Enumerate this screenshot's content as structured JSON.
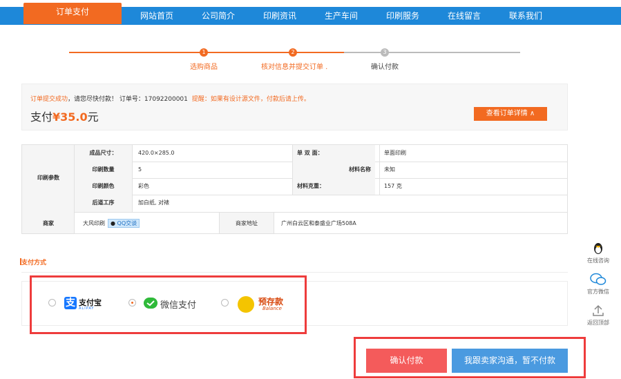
{
  "nav": {
    "active": "订单支付",
    "items": [
      "网站首页",
      "公司简介",
      "印刷资讯",
      "生产车间",
      "印刷服务",
      "在线留言",
      "联系我们"
    ]
  },
  "steps": {
    "items": [
      {
        "num": "1",
        "label": "选购商品"
      },
      {
        "num": "2",
        "label": "核对信息并提交订单 ."
      },
      {
        "num": "3",
        "label": "确认付款"
      }
    ]
  },
  "order": {
    "success": "订单提交成功",
    "pay_prompt": "，请您尽快付款！ 订单号：",
    "order_no": "17092200001",
    "tip": "提醒：如果有设计源文件，付款后请上传。",
    "pay_label": "支付",
    "price": "¥35.0",
    "unit": "元",
    "detail_button": "查看订单详情 ∧"
  },
  "params": {
    "section_label": "印刷参数",
    "rows": [
      {
        "l1": "成品尺寸：",
        "v1": "420.0×285.0",
        "l2": "单 双 面：",
        "v2": "单面印刷"
      },
      {
        "l1": "印刷数量",
        "v1": "5",
        "l2": "材料名称",
        "v2": "未知"
      },
      {
        "l1": "印刷颜色",
        "v1": "彩色",
        "l2": "材料克重：",
        "v2": "157 克"
      },
      {
        "l1": "后道工序",
        "v1": "加白纸, 对裱",
        "l2": "",
        "v2": ""
      }
    ],
    "merchant_label": "商家",
    "merchant_name": "大风印刷",
    "qq_chat": "QQ交谈",
    "address_label": "商家地址",
    "address": "广州白云区和泰盛业广场508A"
  },
  "payment": {
    "title": "支付方式",
    "alipay": {
      "cn": "支付宝",
      "en": "ALIPAY"
    },
    "wechat": "微信支付",
    "balance": {
      "cn": "预存款",
      "en": "Balance"
    },
    "selected": "wechat"
  },
  "buttons": {
    "confirm": "确认付款",
    "contact": "我跟卖家沟通，暂不付款"
  },
  "side": {
    "online": "在线咨询",
    "wechat": "官方微信",
    "top": "返回顶部"
  },
  "colors": {
    "nav_blue": "#1e88d9",
    "accent_orange": "#f26a21",
    "confirm_red": "#f45b5b",
    "contact_blue": "#4a9ae0",
    "frame_red": "#ee3c3c"
  }
}
